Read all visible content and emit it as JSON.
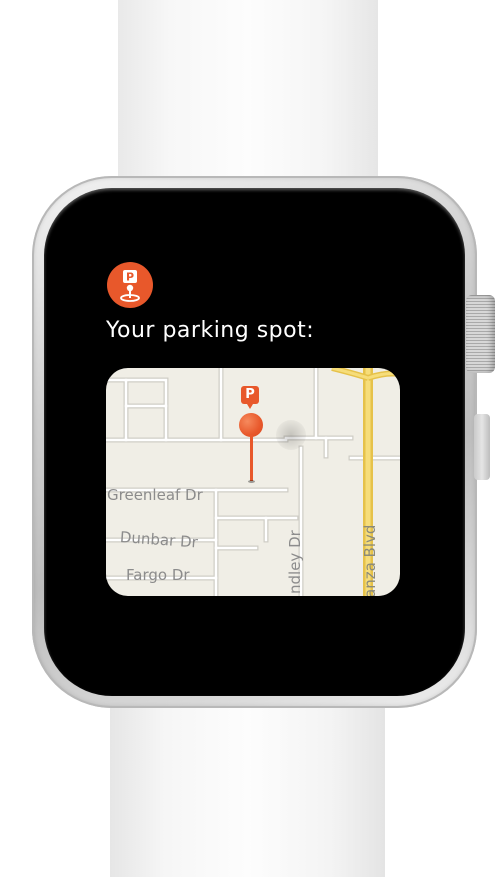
{
  "app": {
    "icon": "parking-pin-icon",
    "accent_color": "#e8582b"
  },
  "screen": {
    "title": "Your parking spot:"
  },
  "map": {
    "pin_badge": "P",
    "streets": {
      "greenleaf": "Greenleaf Dr",
      "dunbar": "Dunbar Dr",
      "fargo": "Fargo Dr",
      "handley": "ndley Dr",
      "boulevard": "anza Blvd"
    }
  }
}
